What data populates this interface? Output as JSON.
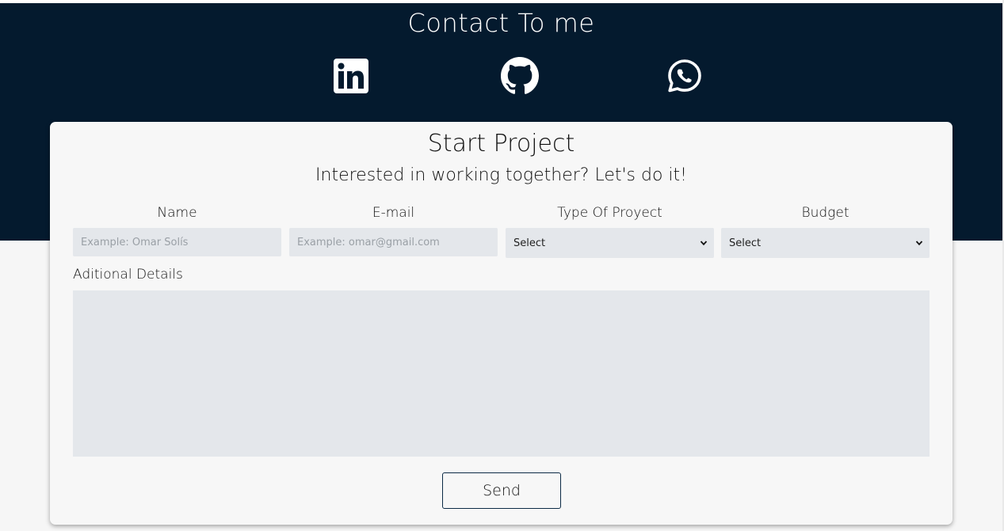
{
  "header": {
    "title": "Contact To me",
    "social": [
      {
        "icon": "linkedin-icon"
      },
      {
        "icon": "github-icon"
      },
      {
        "icon": "whatsapp-icon"
      }
    ]
  },
  "form": {
    "title": "Start Project",
    "subtitle": "Interested in working together? Let's do it!",
    "name": {
      "label": "Name",
      "placeholder": "Example: Omar Solís",
      "value": ""
    },
    "email": {
      "label": "E-mail",
      "placeholder": "Example: omar@gmail.com",
      "value": ""
    },
    "project_type": {
      "label": "Type Of Proyect",
      "selected": "Select"
    },
    "budget": {
      "label": "Budget",
      "selected": "Select"
    },
    "details": {
      "label": "Aditional Details",
      "value": ""
    },
    "send_label": "Send"
  },
  "colors": {
    "hero_background": "#041a2e",
    "card_background": "#f7f7f7",
    "input_background": "#e4e7eb",
    "button_border": "#0c2a45"
  }
}
